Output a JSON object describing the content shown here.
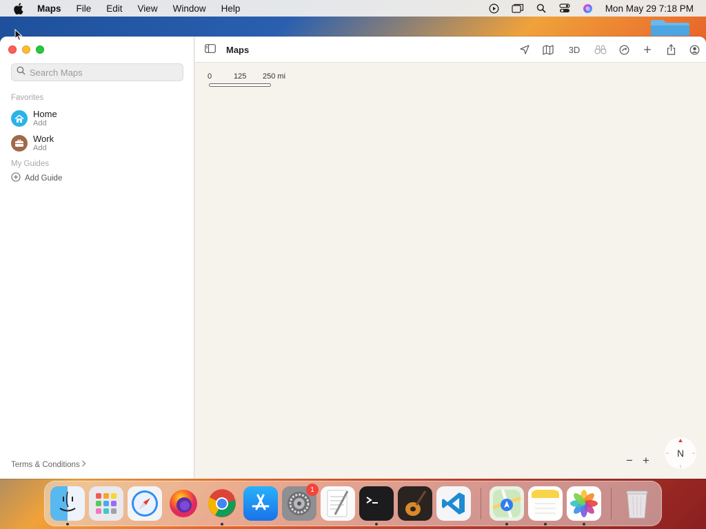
{
  "menubar": {
    "app_name": "Maps",
    "items": [
      "File",
      "Edit",
      "View",
      "Window",
      "Help"
    ],
    "clock": "Mon May 29  7:18 PM"
  },
  "window": {
    "title": "Maps",
    "search": {
      "placeholder": "Search Maps",
      "value": ""
    },
    "favorites_label": "Favorites",
    "favorites": [
      {
        "title": "Home",
        "subtitle": "Add",
        "icon": "house-icon",
        "color": "#2bb3e8"
      },
      {
        "title": "Work",
        "subtitle": "Add",
        "icon": "briefcase-icon",
        "color": "#a0694a"
      }
    ],
    "guides_label": "My Guides",
    "add_guide_label": "Add Guide",
    "terms_label": "Terms & Conditions",
    "toolbar": {
      "three_d_label": "3D",
      "icons": [
        "location-arrow-icon",
        "map-icon",
        "3d-toggle",
        "look-around-binoculars-icon",
        "drive-icon",
        "add-icon",
        "share-icon",
        "account-icon"
      ]
    },
    "map": {
      "scale_labels": [
        "0",
        "125",
        "250 mi"
      ],
      "compass_label": "N",
      "zoom_out_label": "−",
      "zoom_in_label": "+"
    }
  },
  "dock": {
    "apps": [
      {
        "name": "Finder",
        "running": true
      },
      {
        "name": "Launchpad",
        "running": false
      },
      {
        "name": "Safari",
        "running": false
      },
      {
        "name": "Firefox",
        "running": false
      },
      {
        "name": "Chrome",
        "running": true
      },
      {
        "name": "App Store",
        "running": false
      },
      {
        "name": "System Preferences",
        "running": false,
        "badge": "1"
      },
      {
        "name": "TextEdit",
        "running": false
      },
      {
        "name": "Terminal",
        "running": true
      },
      {
        "name": "GarageBand",
        "running": false
      },
      {
        "name": "Visual Studio Code",
        "running": false
      },
      {
        "name": "Maps",
        "running": true
      },
      {
        "name": "Notes",
        "running": true
      },
      {
        "name": "Photos",
        "running": true
      },
      {
        "name": "Trash",
        "running": false
      }
    ]
  },
  "colors": {
    "accent_blue": "#2bb3e8",
    "work_brown": "#a0694a",
    "map_background": "#f6f2ec"
  }
}
